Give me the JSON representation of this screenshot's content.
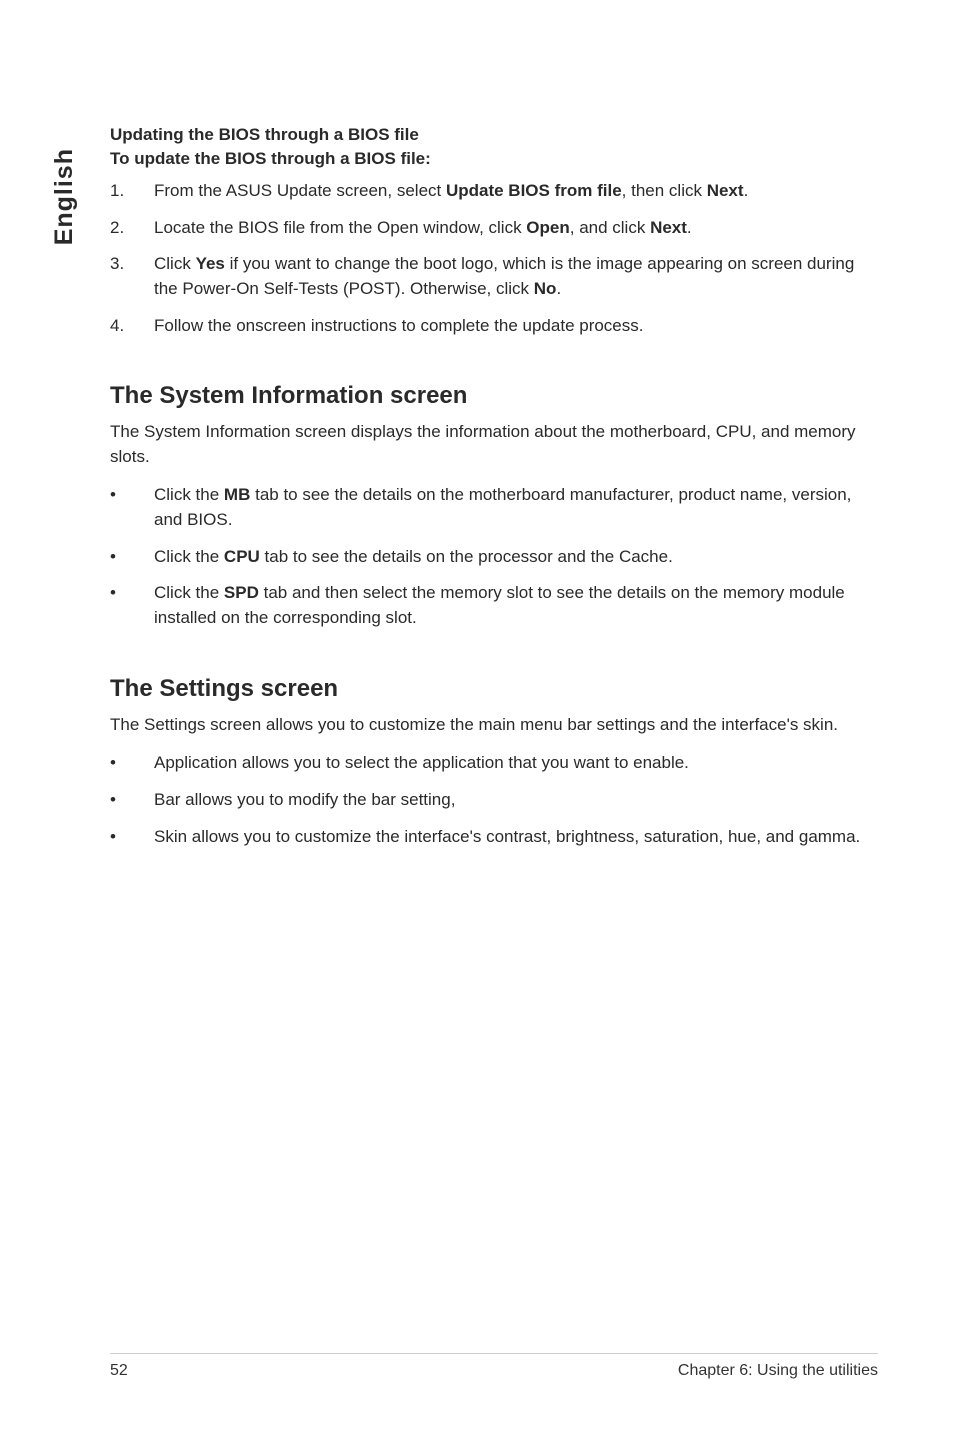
{
  "side_tab": "English",
  "bios_file": {
    "heading1": "Updating the BIOS through a BIOS file",
    "heading2": "To update the BIOS through a BIOS file:",
    "steps": [
      {
        "num": "1.",
        "pre": "From the ASUS Update screen, select ",
        "bold1": "Update BIOS from file",
        "mid": ", then click ",
        "bold2": "Next",
        "post": "."
      },
      {
        "num": "2.",
        "pre": "Locate the BIOS file from the Open window, click ",
        "bold1": "Open",
        "mid": ", and click ",
        "bold2": "Next",
        "post": "."
      },
      {
        "num": "3.",
        "pre": "Click ",
        "bold1": "Yes",
        "mid": " if you want to change the boot logo, which is the image appearing on screen during the Power-On Self-Tests (POST). Otherwise, click ",
        "bold2": "No",
        "post": "."
      },
      {
        "num": "4.",
        "text": "Follow the onscreen instructions to complete the update process."
      }
    ]
  },
  "sysinfo": {
    "title": "The System Information screen",
    "intro": "The System Information screen displays the information about the motherboard, CPU, and memory slots.",
    "items": [
      {
        "pre": "Click the ",
        "bold": "MB",
        "post": " tab to see the details on the motherboard manufacturer, product name, version, and BIOS."
      },
      {
        "pre": "Click the ",
        "bold": "CPU",
        "post": " tab to see the details on the processor and the Cache."
      },
      {
        "pre": "Click the ",
        "bold": "SPD",
        "post": " tab and then select the memory slot to see the details on the memory module installed on the corresponding slot."
      }
    ]
  },
  "settings": {
    "title": "The Settings screen",
    "intro": "The Settings screen allows you to customize the main menu bar settings and the interface's skin.",
    "items": [
      "Application allows you to select the application that you want to enable.",
      "Bar allows you to modify the bar setting,",
      "Skin allows you to customize the interface's contrast, brightness, saturation, hue, and gamma."
    ]
  },
  "footer": {
    "page_no": "52",
    "chapter": "Chapter 6: Using the utilities"
  },
  "bullet": "•"
}
